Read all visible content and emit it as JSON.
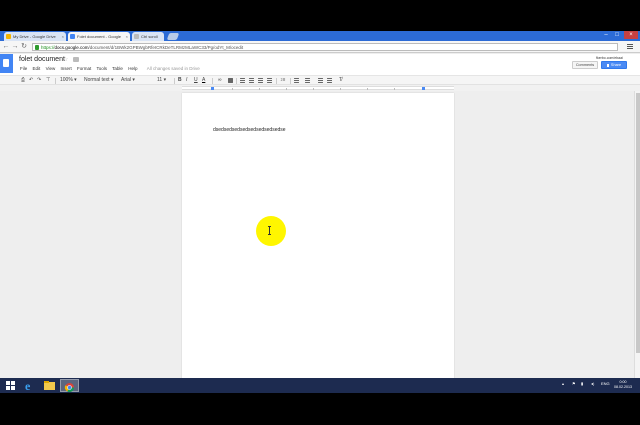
{
  "browser": {
    "tabs": [
      {
        "title": "My Drive - Google Drive",
        "fav_color": "#f4b400"
      },
      {
        "title": "Folet document - Google",
        "fav_color": "#4285f4"
      },
      {
        "title": "Ctrl scroll",
        "fav_color": "#bbbbbb"
      }
    ],
    "url_scheme": "https://",
    "url_domain": "docs.google.com",
    "url_path": "/document/d/1BWk2GPBWgbRfeICRkDeTLRMzMLaWC33/Pg/odYt_M/ocedit"
  },
  "docs": {
    "title": "folet document",
    "menu": [
      "File",
      "Edit",
      "View",
      "Insert",
      "Format",
      "Tools",
      "Table",
      "Help"
    ],
    "saved_status": "All changes saved in Drive",
    "user_email": "fkerbo.com/ebaai",
    "comments_label": "Comments",
    "share_label": "Share",
    "zoom": "100%",
    "style": "Normal text",
    "font": "Arial",
    "font_size": "11",
    "bold": "B",
    "italic": "I",
    "underline": "U",
    "body_text": "dsedsedsedsedsedsedsedsedse"
  },
  "taskbar": {
    "lang": "ENG",
    "time": "0:00",
    "date": "08.02.2013"
  },
  "colors": {
    "accent": "#4285f4",
    "share": "#4a8af4",
    "highlight": "#fff600",
    "taskbar": "#1d2b50"
  }
}
